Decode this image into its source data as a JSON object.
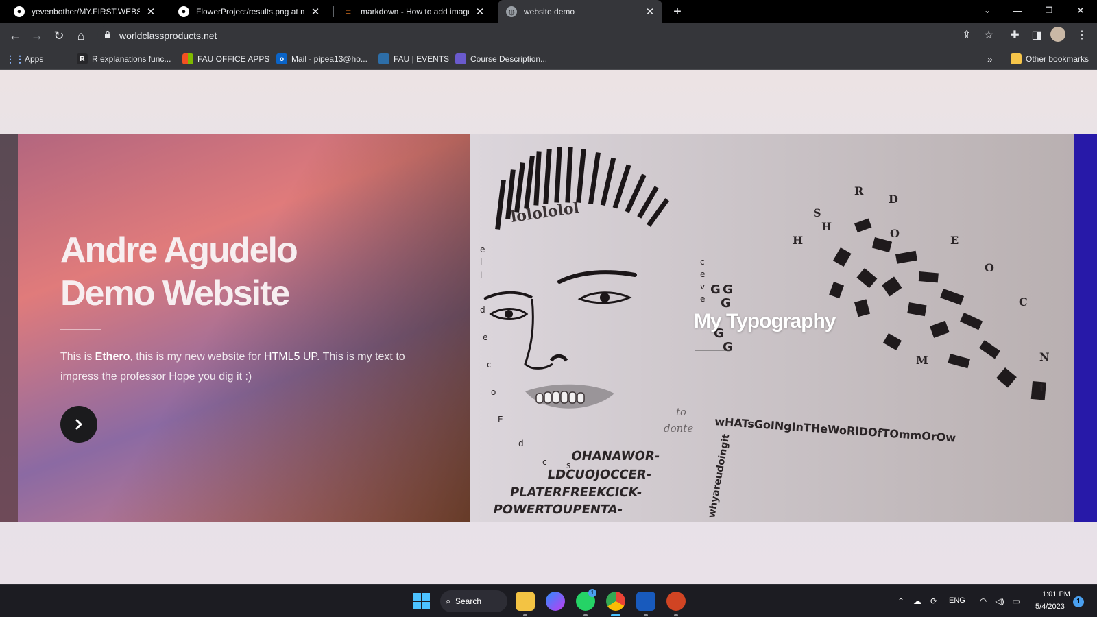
{
  "browser": {
    "tabs": [
      {
        "title": "yevenbother/MY.FIRST.WEBSITE:",
        "icon": "github-icon",
        "close": "✕"
      },
      {
        "title": "FlowerProject/results.png at mai",
        "icon": "github-icon",
        "close": "✕"
      },
      {
        "title": "markdown - How to add images",
        "icon": "stackoverflow-icon",
        "close": "✕"
      },
      {
        "title": "website demo",
        "icon": "globe-icon",
        "close": "✕"
      }
    ],
    "new_tab": "+",
    "url": "worldclassproducts.net"
  },
  "bookmarks": {
    "apps_label": "Apps",
    "items": [
      {
        "label": "R explanations func...",
        "badge": "R"
      },
      {
        "label": "FAU OFFICE APPS",
        "badge": ""
      },
      {
        "label": "Mail - pipea13@ho...",
        "badge": "o"
      },
      {
        "label": "FAU | EVENTS",
        "badge": ""
      },
      {
        "label": "Course Description...",
        "badge": ""
      }
    ],
    "overflow": "»",
    "other_label": "Other bookmarks"
  },
  "hero": {
    "title_line1": "Andre Agudelo",
    "title_line2": "Demo Website",
    "text_prefix": "This is ",
    "text_bold": "Ethero",
    "text_mid": ", this is my new website for ",
    "text_link": "HTML5 UP",
    "text_suffix": ". This is my text to impress the professor Hope you dig it :)"
  },
  "typography": {
    "heading": "My Typography",
    "art_text": {
      "sentence": "wHATsGoINgInTHeWoRlDOfTOmmOrOw",
      "line1": "OHANAWOR-",
      "line2": "LDCUOJOCCER-",
      "line3": "PLATERFREEKCICK-",
      "line4": "POWERTOUPENTA-",
      "chant": "lolololol",
      "side": "whyareudoingit",
      "small": "to",
      "small2": "donte"
    }
  },
  "taskbar": {
    "search_label": "Search",
    "whatsapp_badge": "1",
    "lang": "ENG",
    "time": "1:01 PM",
    "date": "5/4/2023",
    "notif_count": "1"
  },
  "colors": {
    "hero_right_accent": "#2719a8",
    "button_dark": "#1b1b1d"
  }
}
